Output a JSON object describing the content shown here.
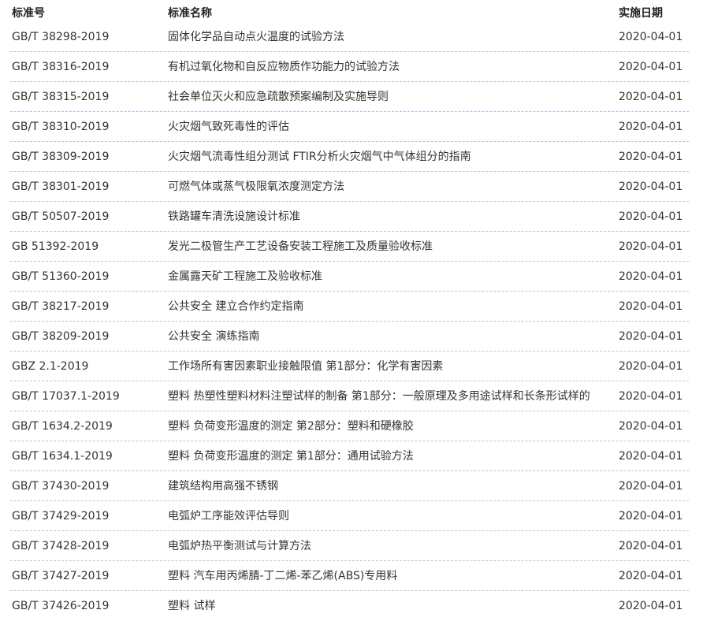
{
  "table": {
    "headers": {
      "code": "标准号",
      "name": "标准名称",
      "date": "实施日期"
    },
    "rows": [
      {
        "code": "GB/T 38298-2019",
        "name": "固体化学品自动点火温度的试验方法",
        "date": "2020-04-01"
      },
      {
        "code": "GB/T 38316-2019",
        "name": "有机过氧化物和自反应物质作功能力的试验方法",
        "date": "2020-04-01"
      },
      {
        "code": "GB/T 38315-2019",
        "name": "社会单位灭火和应急疏散预案编制及实施导则",
        "date": "2020-04-01"
      },
      {
        "code": "GB/T 38310-2019",
        "name": "火灾烟气致死毒性的评估",
        "date": "2020-04-01"
      },
      {
        "code": "GB/T 38309-2019",
        "name": "火灾烟气流毒性组分测试 FTIR分析火灾烟气中气体组分的指南",
        "date": "2020-04-01"
      },
      {
        "code": "GB/T 38301-2019",
        "name": "可燃气体或蒸气极限氧浓度测定方法",
        "date": "2020-04-01"
      },
      {
        "code": "GB/T 50507-2019",
        "name": "铁路罐车清洗设施设计标准",
        "date": "2020-04-01"
      },
      {
        "code": "GB 51392-2019",
        "name": "发光二极管生产工艺设备安装工程施工及质量验收标准",
        "date": "2020-04-01"
      },
      {
        "code": "GB/T 51360-2019",
        "name": "金属露天矿工程施工及验收标准",
        "date": "2020-04-01"
      },
      {
        "code": "GB/T 38217-2019",
        "name": "公共安全 建立合作约定指南",
        "date": "2020-04-01"
      },
      {
        "code": "GB/T 38209-2019",
        "name": "公共安全 演练指南",
        "date": "2020-04-01"
      },
      {
        "code": "GBZ 2.1-2019",
        "name": "工作场所有害因素职业接触限值 第1部分：化学有害因素",
        "date": "2020-04-01"
      },
      {
        "code": "GB/T 17037.1-2019",
        "name": "塑料 热塑性塑料材料注塑试样的制备 第1部分：一般原理及多用途试样和长条形试样的",
        "date": "2020-04-01"
      },
      {
        "code": "GB/T 1634.2-2019",
        "name": "塑料 负荷变形温度的测定 第2部分：塑料和硬橡胶",
        "date": "2020-04-01"
      },
      {
        "code": "GB/T 1634.1-2019",
        "name": "塑料 负荷变形温度的测定 第1部分：通用试验方法",
        "date": "2020-04-01"
      },
      {
        "code": "GB/T 37430-2019",
        "name": "建筑结构用高强不锈钢",
        "date": "2020-04-01"
      },
      {
        "code": "GB/T 37429-2019",
        "name": "电弧炉工序能效评估导则",
        "date": "2020-04-01"
      },
      {
        "code": "GB/T 37428-2019",
        "name": "电弧炉热平衡测试与计算方法",
        "date": "2020-04-01"
      },
      {
        "code": "GB/T 37427-2019",
        "name": "塑料 汽车用丙烯腈-丁二烯-苯乙烯(ABS)专用料",
        "date": "2020-04-01"
      },
      {
        "code": "GB/T 37426-2019",
        "name": "塑料 试样",
        "date": "2020-04-01"
      }
    ]
  }
}
